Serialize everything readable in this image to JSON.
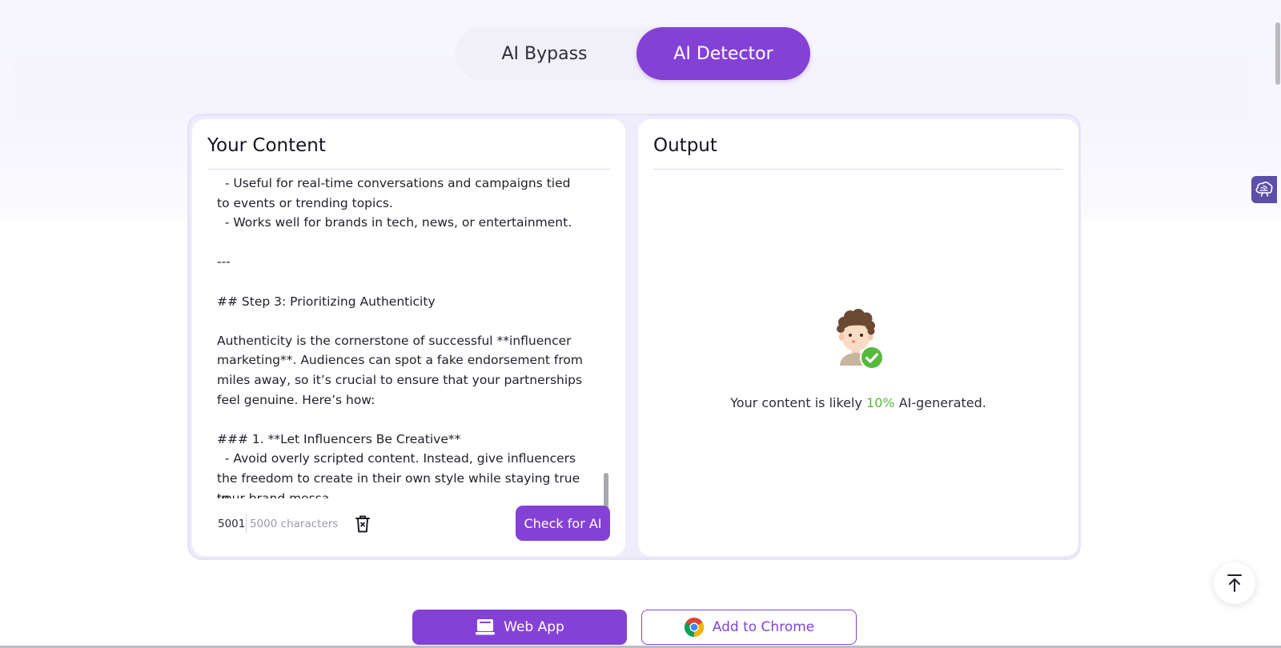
{
  "tabs": {
    "bypass_label": "AI Bypass",
    "detector_label": "AI Detector",
    "active": "AI Detector"
  },
  "input_panel": {
    "title": "Your Content",
    "content_lines": [
      "  - Useful for real-time conversations and campaigns tied",
      "to events or trending topics.",
      "  - Works well for brands in tech, news, or entertainment.",
      "",
      "---",
      "",
      "## Step 3: Prioritizing Authenticity",
      "",
      "Authenticity is the cornerstone of successful **influencer",
      "marketing**. Audiences can spot a fake endorsement from",
      "miles away, so it’s crucial to ensure that your partnerships",
      "feel genuine. Here’s how:",
      "",
      "### 1. **Let Influencers Be Creative**",
      "  - Avoid overly scripted content. Instead, give influencers",
      "the freedom to create in their own style while staying true to",
      "your brand messa"
    ],
    "char_count": "5001",
    "char_limit": "5000 characters",
    "check_button": "Check for AI"
  },
  "output_panel": {
    "title": "Output",
    "result_prefix": "Your content is likely",
    "result_percent": "10%",
    "result_suffix": "AI-generated."
  },
  "footer_buttons": {
    "web_app": "Web App",
    "add_to_chrome": "Add to Chrome"
  },
  "colors": {
    "accent": "#8441d6",
    "result_green": "#56b93e"
  },
  "icons": {
    "trash": "trash-icon",
    "avatar": "human-check-avatar-icon",
    "back_to_top": "arrow-up-to-line-icon",
    "side_widget": "brain-icon",
    "laptop": "laptop-icon",
    "chrome": "chrome-logo-icon"
  }
}
